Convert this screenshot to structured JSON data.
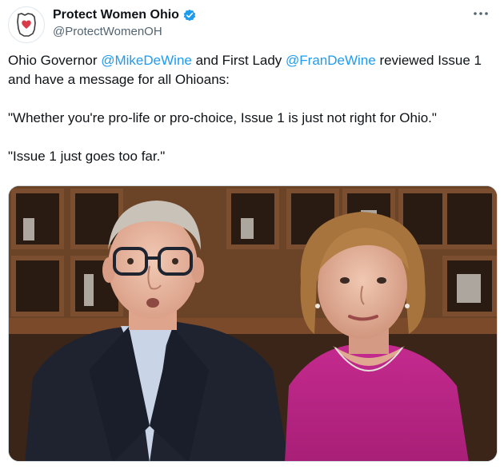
{
  "author": {
    "display_name": "Protect Women Ohio",
    "handle": "@ProtectWomenOH",
    "verified": true,
    "avatar_icon": "ohio-heart-logo-icon",
    "verified_icon": "verified-badge-icon"
  },
  "menu": {
    "icon": "more-horizontal-icon"
  },
  "tweet": {
    "line1_prefix": "Ohio Governor ",
    "mention1": "@MikeDeWine",
    "line1_mid": " and First Lady ",
    "mention2": "@FranDeWine",
    "line1_suffix": " reviewed Issue 1 and have a message for all Ohioans:",
    "quote1": "\"Whether you're pro-life or pro-choice, Issue 1 is just not right for Ohio.\"",
    "quote2": "\"Issue 1 just goes too far.\""
  },
  "media": {
    "type": "video-thumbnail",
    "subject": "photo of a man in a suit and a woman in a magenta top in a kitchen"
  },
  "colors": {
    "link": "#1d9bf0",
    "verified": "#1d9bf0",
    "text": "#0f1419",
    "secondary": "#536471"
  }
}
